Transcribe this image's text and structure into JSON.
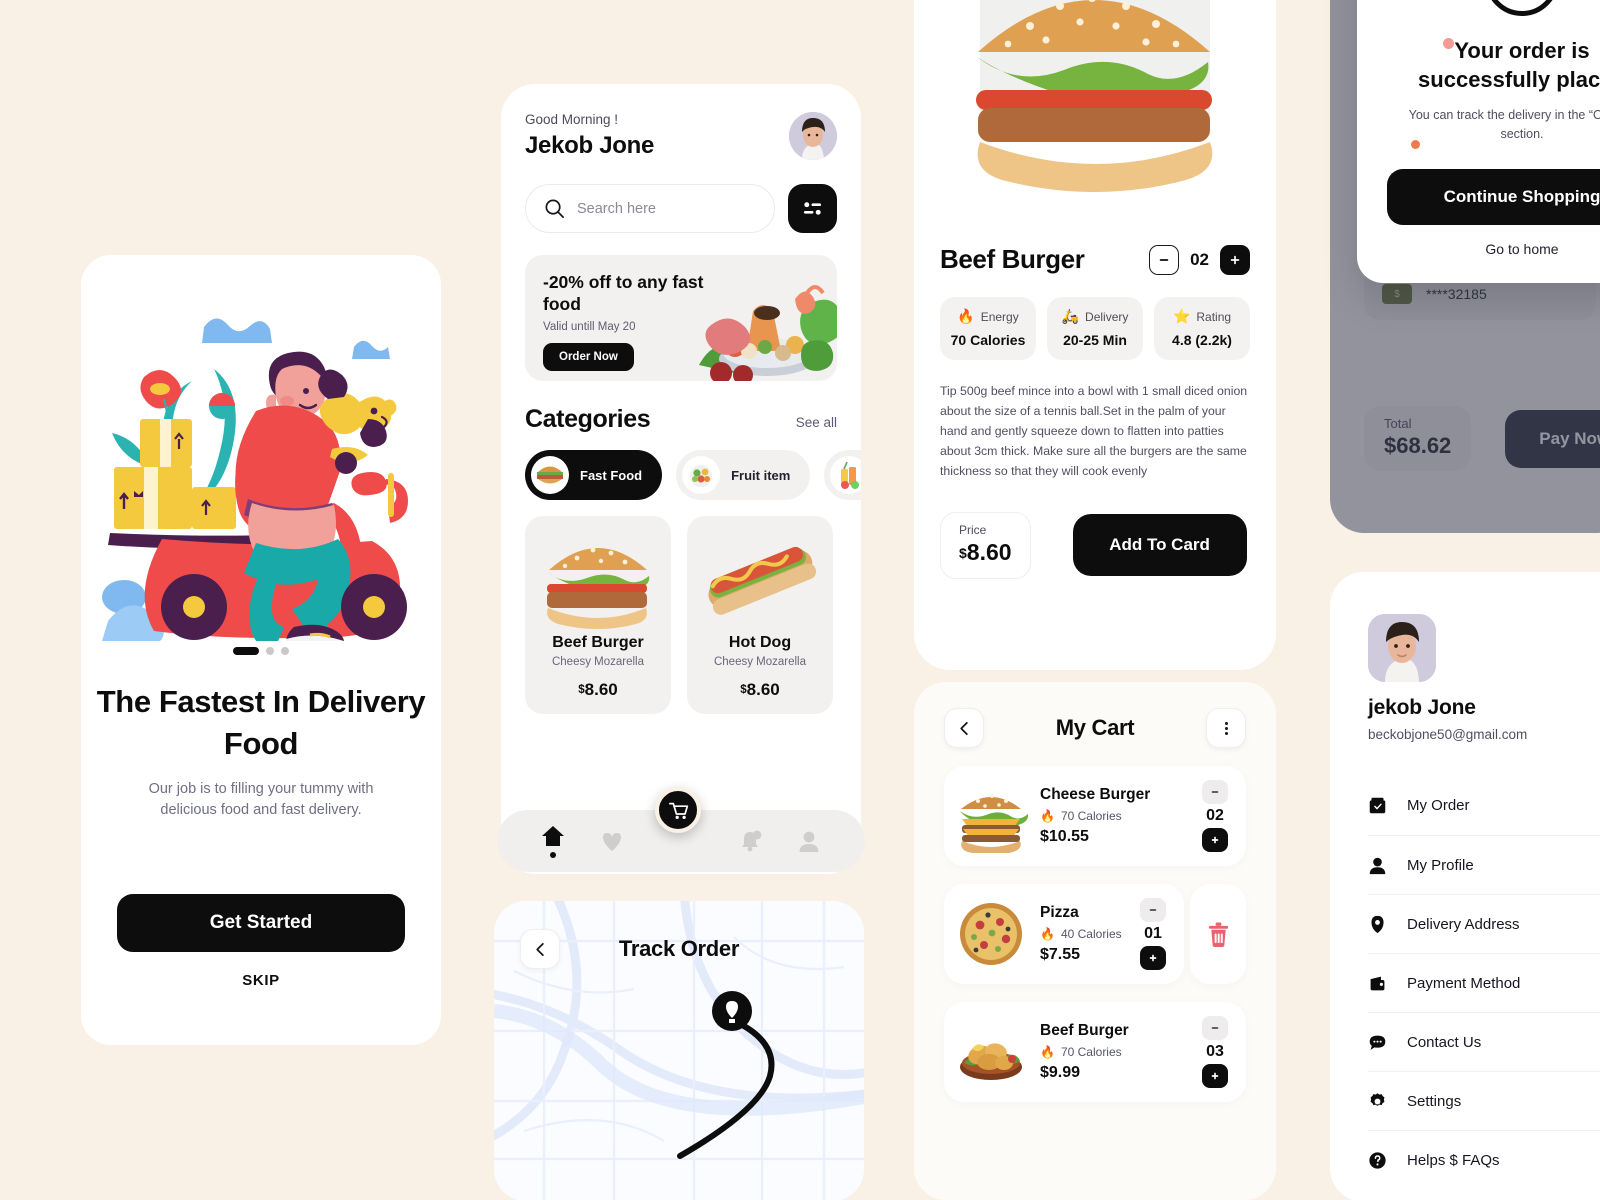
{
  "theme": {
    "background": "#faf1e6",
    "accent_dark": "#0d0d0d",
    "card_grey": "#f3f1ef",
    "danger": "#e8636d"
  },
  "onboarding": {
    "title": "The Fastest In Delivery Food",
    "subtitle": "Our job is to filling your tummy with delicious food and fast delivery.",
    "cta_label": "Get Started",
    "skip_label": "SKIP",
    "pager_count": 3,
    "pager_active": 0
  },
  "home": {
    "greeting": "Good Morning !",
    "user_name": "Jekob Jone",
    "search_placeholder": "Search here",
    "promo": {
      "title": "-20% off to any fast food",
      "validity": "Valid untill May 20",
      "button_label": "Order Now"
    },
    "categories_title": "Categories",
    "see_all_label": "See all",
    "categories": [
      {
        "label": "Fast Food",
        "icon": "burger-icon",
        "active": true
      },
      {
        "label": "Fruit item",
        "icon": "fruit-bowl-icon",
        "active": false
      },
      {
        "label": "",
        "icon": "juice-icon",
        "active": false
      }
    ],
    "products": [
      {
        "name": "Beef Burger",
        "desc": "Cheesy Mozarella",
        "currency": "$",
        "price": "8.60",
        "image": "burger-photo"
      },
      {
        "name": "Hot Dog",
        "desc": "Cheesy Mozarella",
        "currency": "$",
        "price": "8.60",
        "image": "hotdog-photo"
      }
    ],
    "tabs": [
      {
        "name": "home",
        "active": true
      },
      {
        "name": "favorites",
        "active": false
      },
      {
        "name": "cart",
        "active": false
      },
      {
        "name": "notifications",
        "active": false
      },
      {
        "name": "profile",
        "active": false
      }
    ]
  },
  "track_order": {
    "title": "Track Order"
  },
  "detail": {
    "title": "Beef Burger",
    "quantity": "02",
    "stats": [
      {
        "emoji": "🔥",
        "label": "Energy",
        "value": "70 Calories"
      },
      {
        "emoji": "🛵",
        "label": "Delivery",
        "value": "20-25 Min"
      },
      {
        "emoji": "⭐",
        "label": "Rating",
        "value": "4.8 (2.2k)"
      }
    ],
    "description": "Tip 500g beef mince into a bowl with 1 small diced onion about the size of a tennis ball.Set in the palm of your hand and gently squeeze down to flatten into patties about 3cm thick. Make sure all the burgers are the same thickness so that they will cook evenly",
    "price_label": "Price",
    "price_currency": "$",
    "price_value": "8.60",
    "add_button_label": "Add To Card"
  },
  "cart": {
    "title": "My Cart",
    "items": [
      {
        "name": "Cheese Burger",
        "calories": "70 Calories",
        "price": "$10.55",
        "qty": "02",
        "image": "cheeseburger-photo",
        "swiped": false
      },
      {
        "name": "Pizza",
        "calories": "40 Calories",
        "price": "$7.55",
        "qty": "01",
        "image": "pizza-photo",
        "swiped": true
      },
      {
        "name": "Beef Burger",
        "calories": "70 Calories",
        "price": "$9.99",
        "qty": "03",
        "image": "chicken-photo",
        "swiped": false
      }
    ]
  },
  "payment": {
    "card_number": "****32185",
    "total_label": "Total",
    "total_value": "$68.62",
    "pay_button_label": "Pay Now",
    "success": {
      "title": "Your order is successfully placed",
      "subtitle": "You can track the delivery in the “Orders” section.",
      "primary_label": "Continue Shopping",
      "secondary_label": "Go to home"
    }
  },
  "profile": {
    "name": "jekob Jone",
    "email": "beckobjone50@gmail.com",
    "menu": [
      {
        "label": "My Order",
        "icon": "order-box-icon"
      },
      {
        "label": "My Profile",
        "icon": "person-icon"
      },
      {
        "label": "Delivery Address",
        "icon": "location-pin-icon"
      },
      {
        "label": "Payment Method",
        "icon": "wallet-icon"
      },
      {
        "label": "Contact Us",
        "icon": "chat-bubble-icon"
      },
      {
        "label": "Settings",
        "icon": "gear-icon"
      },
      {
        "label": "Helps $ FAQs",
        "icon": "question-icon"
      }
    ]
  }
}
